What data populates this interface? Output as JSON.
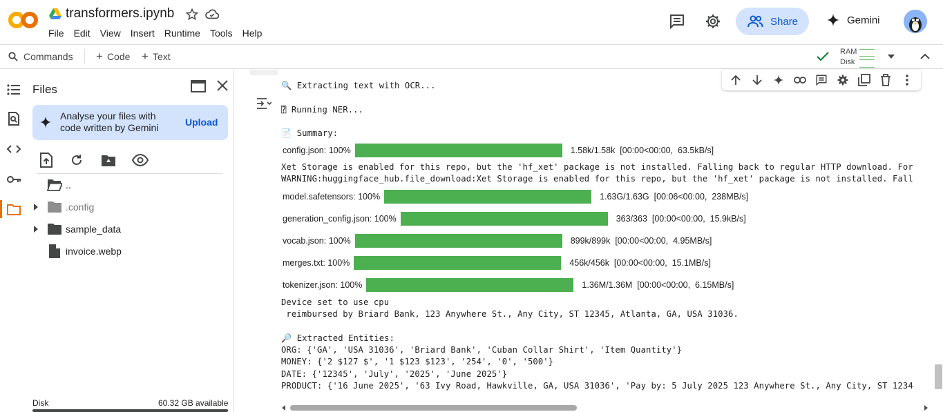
{
  "header": {
    "title": "transformers.ipynb",
    "menu": [
      "File",
      "Edit",
      "View",
      "Insert",
      "Runtime",
      "Tools",
      "Help"
    ],
    "share_label": "Share",
    "gemini_label": "Gemini",
    "accent": "#0b57d0",
    "share_bg": "#d3e3fd"
  },
  "toolbar": {
    "commands_label": "Commands",
    "code_label": "Code",
    "text_label": "Text",
    "ram_label": "RAM",
    "disk_label": "Disk"
  },
  "sidebar": {
    "title": "Files",
    "gemini_card_text": "Analyse your files with code written by Gemini",
    "upload_label": "Upload",
    "tree": [
      {
        "label": "..",
        "type": "folder-open"
      },
      {
        "label": ".config",
        "type": "folder",
        "muted": true
      },
      {
        "label": "sample_data",
        "type": "folder"
      },
      {
        "label": "invoice.webp",
        "type": "file"
      }
    ],
    "disk_label": "Disk",
    "disk_available": "60.32 GB available"
  },
  "output": {
    "line_ocr": "🔍 Extracting text with OCR...",
    "line_ner": "⍰ Running NER...",
    "line_summary": "📄 Summary:",
    "progress": [
      {
        "name": "config.json:",
        "pct": "100%",
        "stats": "1.58k/1.58k  [00:00<00:00,  63.5kB/s]"
      },
      {
        "name": "model.safetensors:",
        "pct": "100%",
        "stats": "1.63G/1.63G  [00:06<00:00,  238MB/s]"
      },
      {
        "name": "generation_config.json:",
        "pct": "100%",
        "stats": "363/363  [00:00<00:00,  15.9kB/s]"
      },
      {
        "name": "vocab.json:",
        "pct": "100%",
        "stats": "899k/899k  [00:00<00:00,  4.95MB/s]"
      },
      {
        "name": "merges.txt:",
        "pct": "100%",
        "stats": "456k/456k  [00:00<00:00,  15.1MB/s]"
      },
      {
        "name": "tokenizer.json:",
        "pct": "100%",
        "stats": "1.36M/1.36M  [00:00<00:00,  6.15MB/s]"
      }
    ],
    "xet_line": "Xet Storage is enabled for this repo, but the 'hf_xet' package is not installed. Falling back to regular HTTP download. For",
    "warning_line": "WARNING:huggingface_hub.file_download:Xet Storage is enabled for this repo, but the 'hf_xet' package is not installed. Fall",
    "device_line": "Device set to use cpu",
    "reimbursed_line": " reimbursed by Briard Bank, 123 Anywhere St., Any City, ST 12345, Atlanta, GA, USA 31036.",
    "entities_header": "🔎 Extracted Entities:",
    "org_line": "ORG: {'GA', 'USA 31036', 'Briard Bank', 'Cuban Collar Shirt', 'Item Quantity'}",
    "money_line": "MONEY: {'2 $127 $', '1 $123 $123', '254', '0', '500'}",
    "date_line": "DATE: {'12345', 'July', '2025', 'June 2025'}",
    "product_line": "PRODUCT: {'16 June 2025', '63 Ivy Road, Hawkville, GA, USA 31036', 'Pay by: 5 July 2025 123 Anywhere St., Any City, ST 1234",
    "bar_color": "#4caf50"
  }
}
